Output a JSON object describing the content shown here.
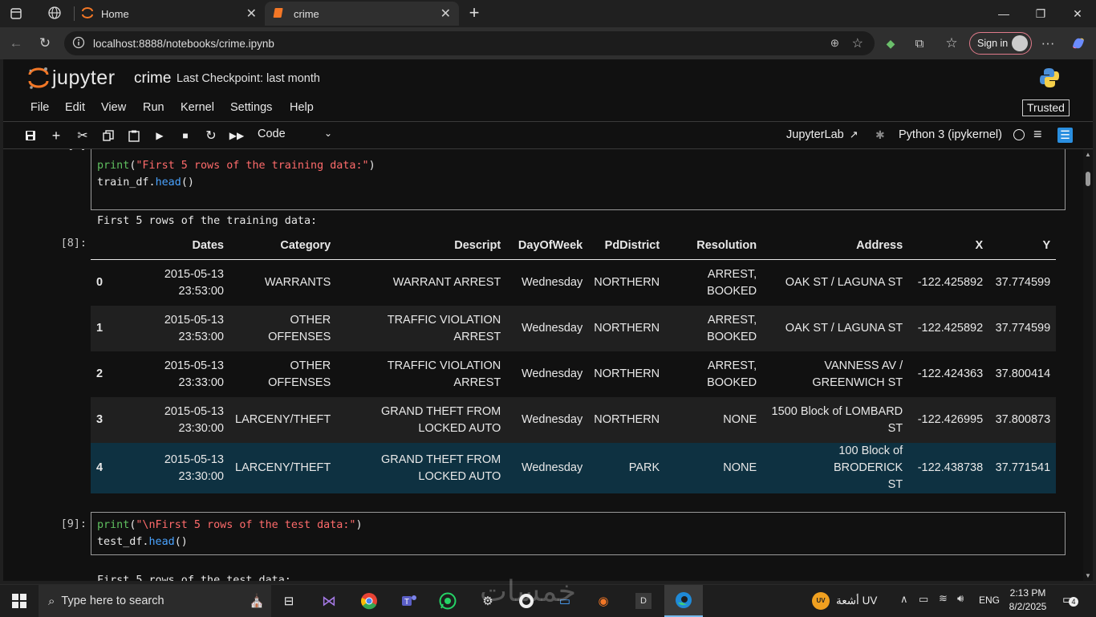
{
  "browser": {
    "tabs": [
      {
        "title": "Home"
      },
      {
        "title": "crime"
      }
    ],
    "url": "localhost:8888/notebooks/crime.ipynb",
    "signin_label": "Sign in"
  },
  "jupyter": {
    "logo_text": "jupyter",
    "notebook_name": "crime",
    "checkpoint": "Last Checkpoint: last month",
    "menu": [
      "File",
      "Edit",
      "View",
      "Run",
      "Kernel",
      "Settings",
      "Help"
    ],
    "trusted_label": "Trusted",
    "cell_type": "Code",
    "jupyterlab_label": "JupyterLab",
    "kernel_name": "Python 3 (ipykernel)"
  },
  "cells": {
    "cell1": {
      "prompt_partial": "[ ]",
      "line1": {
        "fn": "print",
        "open": "(",
        "str": "\"First 5 rows of the training data:\"",
        "close": ")"
      },
      "line2": {
        "obj": "train_df.",
        "method": "head",
        "args": "()"
      },
      "stdout": "First 5 rows of the training data:",
      "out_prompt": "[8]:"
    },
    "cell2": {
      "prompt": "[9]:",
      "line1": {
        "fn": "print",
        "open": "(",
        "str": "\"\\nFirst 5 rows of the test data:\"",
        "close": ")"
      },
      "line2": {
        "obj": "test_df.",
        "method": "head",
        "args": "()"
      },
      "stdout_partial": "First 5 rows of the test data:"
    }
  },
  "table": {
    "columns": [
      "",
      "Dates",
      "Category",
      "Descript",
      "DayOfWeek",
      "PdDistrict",
      "Resolution",
      "Address",
      "X",
      "Y"
    ],
    "rows": [
      {
        "idx": "0",
        "dates_date": "2015-05-13",
        "dates_time": "23:53:00",
        "cat1": "WARRANTS",
        "cat2": "",
        "desc1": "WARRANT ARREST",
        "desc2": "",
        "day": "Wednesday",
        "district": "NORTHERN",
        "res1": "ARREST,",
        "res2": "BOOKED",
        "addr1": "OAK ST / LAGUNA ST",
        "addr2": "",
        "x": "-122.425892",
        "y": "37.774599"
      },
      {
        "idx": "1",
        "dates_date": "2015-05-13",
        "dates_time": "23:53:00",
        "cat1": "OTHER",
        "cat2": "OFFENSES",
        "desc1": "TRAFFIC VIOLATION ARREST",
        "desc2": "",
        "day": "Wednesday",
        "district": "NORTHERN",
        "res1": "ARREST,",
        "res2": "BOOKED",
        "addr1": "OAK ST / LAGUNA ST",
        "addr2": "",
        "x": "-122.425892",
        "y": "37.774599"
      },
      {
        "idx": "2",
        "dates_date": "2015-05-13",
        "dates_time": "23:33:00",
        "cat1": "OTHER",
        "cat2": "OFFENSES",
        "desc1": "TRAFFIC VIOLATION ARREST",
        "desc2": "",
        "day": "Wednesday",
        "district": "NORTHERN",
        "res1": "ARREST,",
        "res2": "BOOKED",
        "addr1": "VANNESS AV /",
        "addr2": "GREENWICH ST",
        "x": "-122.424363",
        "y": "37.800414"
      },
      {
        "idx": "3",
        "dates_date": "2015-05-13",
        "dates_time": "23:30:00",
        "cat1": "LARCENY/THEFT",
        "cat2": "",
        "desc1": "GRAND THEFT FROM",
        "desc2": "LOCKED AUTO",
        "day": "Wednesday",
        "district": "NORTHERN",
        "res1": "NONE",
        "res2": "",
        "addr1": "1500 Block of LOMBARD",
        "addr2": "ST",
        "x": "-122.426995",
        "y": "37.800873"
      },
      {
        "idx": "4",
        "dates_date": "2015-05-13",
        "dates_time": "23:30:00",
        "cat1": "LARCENY/THEFT",
        "cat2": "",
        "desc1": "GRAND THEFT FROM",
        "desc2": "LOCKED AUTO",
        "day": "Wednesday",
        "district": "PARK",
        "res1": "NONE",
        "res2": "",
        "addr1": "100 Block of BRODERICK",
        "addr2": "ST",
        "x": "-122.438738",
        "y": "37.771541"
      }
    ]
  },
  "taskbar": {
    "search_placeholder": "Type here to search",
    "weather_badge": "UV",
    "weather_text": "أشعة UV",
    "language": "ENG",
    "time": "2:13 PM",
    "date": "8/2/2025",
    "notification_count": "4",
    "watermark": "خمسات"
  },
  "colors": {
    "accent_orange": "#f37726",
    "notebook_bg": "#111111",
    "row_stripe": "#202020",
    "row_hover": "#0e3141",
    "print_green": "#5fbf5f",
    "string_red": "#ff6b6b",
    "method_blue": "#4aa3ff"
  }
}
